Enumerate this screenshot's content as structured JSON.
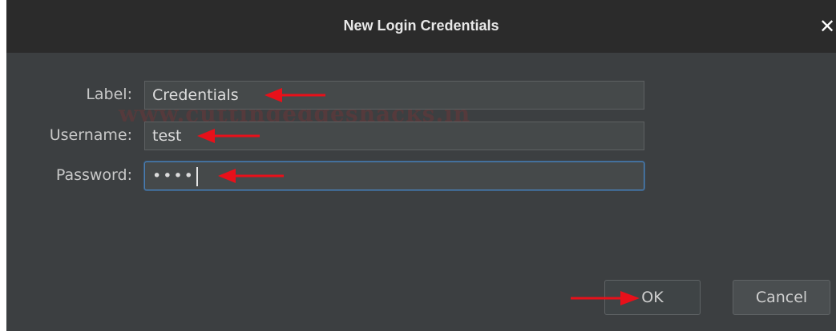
{
  "window": {
    "title": "New Login Credentials",
    "close_glyph": "✕"
  },
  "form": {
    "label_label": "Label:",
    "label_value": "Credentials",
    "username_label": "Username:",
    "username_value": "test",
    "password_label": "Password:",
    "password_mask": "••••"
  },
  "buttons": {
    "ok": "OK",
    "cancel": "Cancel"
  },
  "watermark": "www.cuttingedgeshacks.in",
  "colors": {
    "dialog_bg": "#3c3f41",
    "titlebar_bg": "#2b2b2b",
    "focus_border": "#4a7fb5",
    "annotation_arrow": "#e8101a"
  }
}
